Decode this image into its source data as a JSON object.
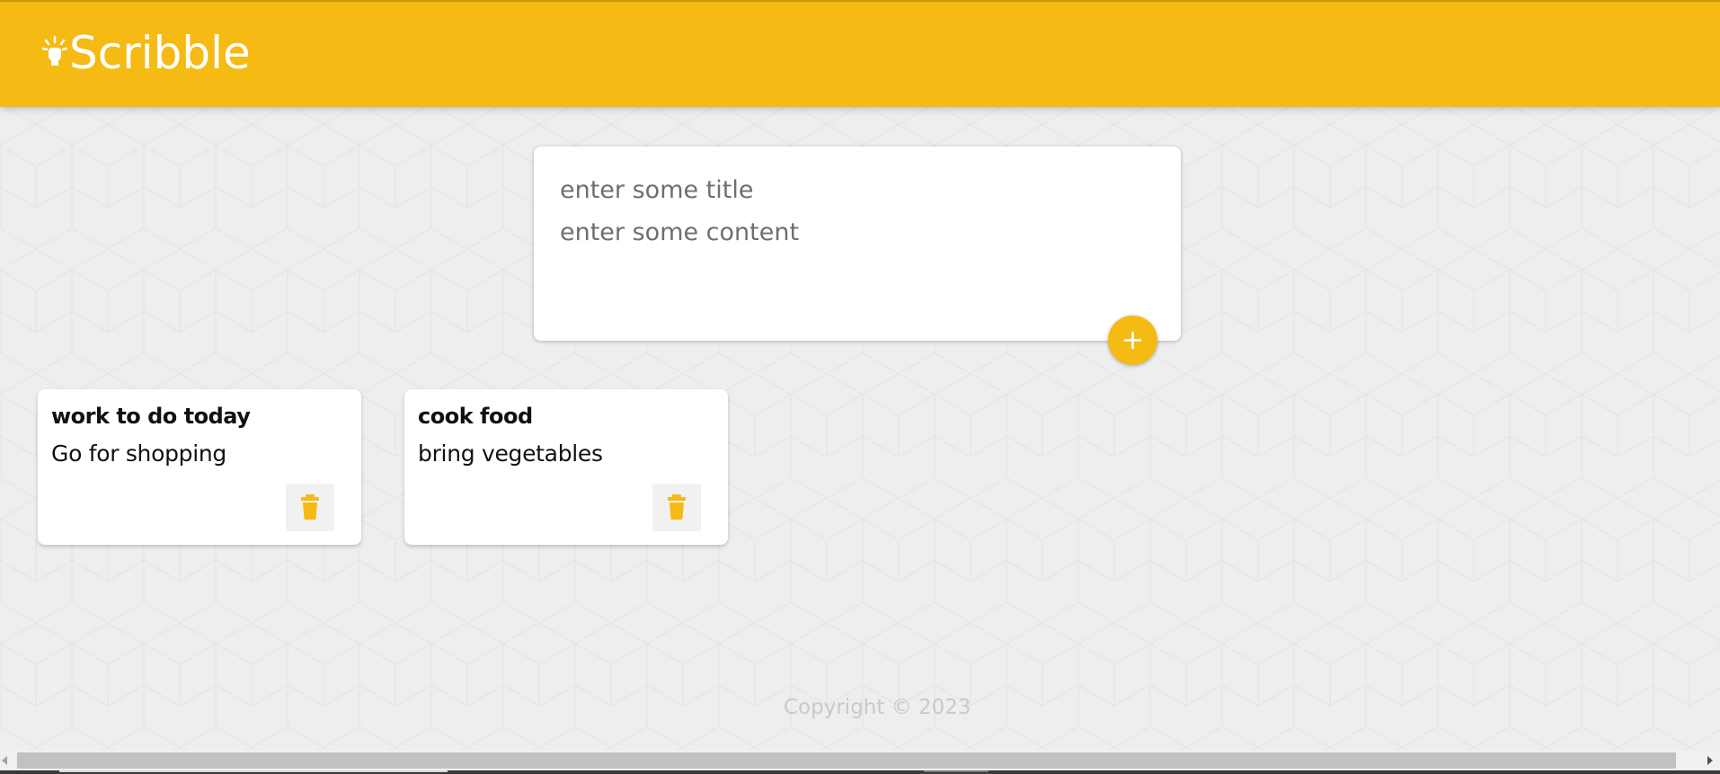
{
  "app": {
    "name": "Scribble",
    "brand_color": "#f5ba13",
    "logo_icon": "lightbulb-icon"
  },
  "create_note": {
    "title_placeholder": "enter some title",
    "content_placeholder": "enter some content",
    "title_value": "",
    "content_value": "",
    "add_icon": "plus-icon"
  },
  "notes": [
    {
      "title": "work to do today",
      "content": "Go for shopping",
      "delete_icon": "trash-icon"
    },
    {
      "title": "cook food",
      "content": "bring vegetables",
      "delete_icon": "trash-icon"
    }
  ],
  "footer": {
    "copyright": "Copyright © 2023"
  }
}
